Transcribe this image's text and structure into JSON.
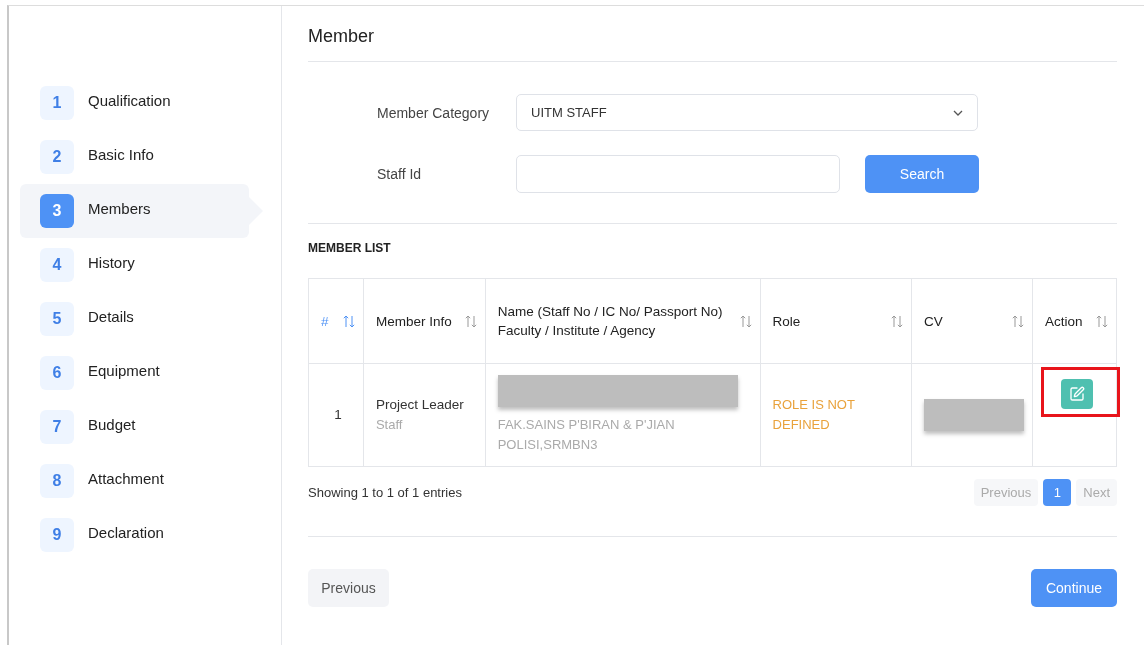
{
  "sidebar": {
    "steps": [
      {
        "number": "1",
        "label": "Qualification",
        "selected": false
      },
      {
        "number": "2",
        "label": "Basic Info",
        "selected": false
      },
      {
        "number": "3",
        "label": "Members",
        "selected": true
      },
      {
        "number": "4",
        "label": "History",
        "selected": false
      },
      {
        "number": "5",
        "label": "Details",
        "selected": false
      },
      {
        "number": "6",
        "label": "Equipment",
        "selected": false
      },
      {
        "number": "7",
        "label": "Budget",
        "selected": false
      },
      {
        "number": "8",
        "label": "Attachment",
        "selected": false
      },
      {
        "number": "9",
        "label": "Declaration",
        "selected": false
      }
    ]
  },
  "page_title": "Member",
  "form": {
    "fields": [
      {
        "kind": "select",
        "label": "Member Category",
        "value": "UITM STAFF"
      },
      {
        "kind": "input",
        "label": "Staff Id",
        "button": "Search"
      }
    ]
  },
  "member_list": {
    "title": "MEMBER LIST",
    "columns": [
      {
        "label": "#",
        "sorted": true
      },
      {
        "label": "Member Info",
        "sorted": false
      },
      {
        "label": "Name (Staff No / IC No/ Passport No)",
        "sublabel": "Faculty / Institute / Agency",
        "sorted": false
      },
      {
        "label": "Role",
        "sorted": false
      },
      {
        "label": "CV",
        "sorted": false
      },
      {
        "label": "Action",
        "sorted": false
      }
    ],
    "rows": [
      {
        "number": "1",
        "member_info": "Project Leader",
        "member_type": "Staff",
        "name_redacted": true,
        "faculty": "FAK.SAINS P'BIRAN & P'JIAN POLISI,SRMBN3",
        "role": "ROLE IS NOT DEFINED",
        "cv_redacted": true,
        "action_highlighted": true
      }
    ],
    "summary": "Showing 1 to 1 of 1 entries",
    "pagination": {
      "previous": {
        "label": "Previous",
        "disabled": true
      },
      "pages": [
        {
          "label": "1",
          "selected": true
        }
      ],
      "next": {
        "label": "Next",
        "disabled": true
      }
    }
  },
  "footer": {
    "previous_button": "Previous",
    "continue_button": "Continue"
  }
}
